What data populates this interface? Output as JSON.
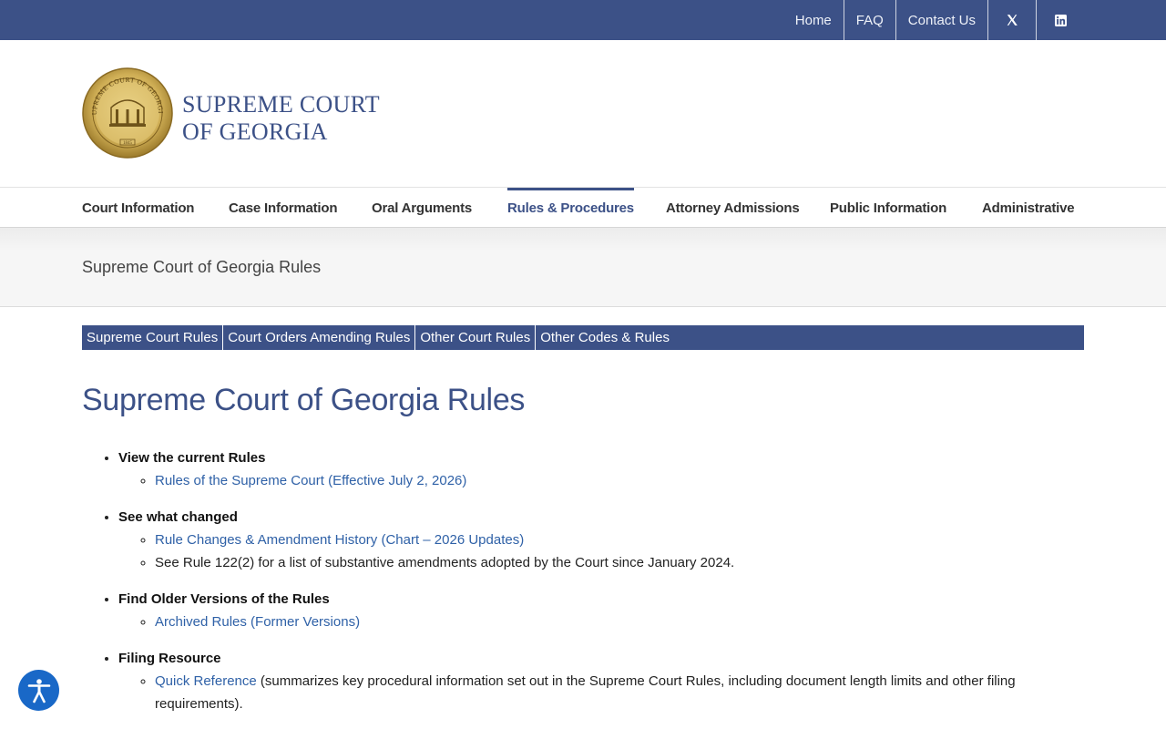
{
  "topnav": {
    "home": "Home",
    "faq": "FAQ",
    "contact": "Contact Us",
    "x_icon": "x-twitter-icon",
    "linkedin_icon": "linkedin-icon"
  },
  "header": {
    "title_line1": "SUPREME COURT",
    "title_line2": "OF GEORGIA",
    "seal_text": "SUPREME COURT OF GEORGIA",
    "seal_year": "1845"
  },
  "mainnav": {
    "items": [
      {
        "label": "Court Information"
      },
      {
        "label": "Case Information"
      },
      {
        "label": "Oral Arguments"
      },
      {
        "label": "Rules & Procedures"
      },
      {
        "label": "Attorney Admissions"
      },
      {
        "label": "Public Information"
      },
      {
        "label": "Administrative"
      }
    ],
    "active_index": 3
  },
  "page_title": "Supreme Court of Georgia Rules",
  "subnav": {
    "items": [
      {
        "label": "Supreme Court Rules"
      },
      {
        "label": "Court Orders Amending Rules"
      },
      {
        "label": "Other Court Rules"
      },
      {
        "label": "Other Codes & Rules"
      }
    ]
  },
  "content": {
    "heading": "Supreme Court of Georgia Rules",
    "sections": [
      {
        "label": "View the current Rules",
        "link": "Rules of the Supreme Court (Effective July 2, 2026)"
      },
      {
        "label": "See what changed",
        "link": "Rule Changes & Amendment History (Chart – 2026 Updates)",
        "note": "See Rule 122(2) for a list of substantive amendments adopted by the Court since January 2024."
      },
      {
        "label": "Find Older Versions of the Rules",
        "link": "Archived Rules (Former Versions)"
      },
      {
        "label": "Filing Resource",
        "link": "Quick Reference",
        "link_suffix": " (summarizes key procedural information set out in the Supreme Court Rules, including document length limits and other filing requirements)."
      }
    ]
  },
  "colors": {
    "brand_blue": "#3c5187",
    "link_blue": "#2f61a7",
    "a11y_blue": "#1968c7",
    "seal_gold": "#c9a84c"
  },
  "a11y_icon": "accessibility-icon"
}
